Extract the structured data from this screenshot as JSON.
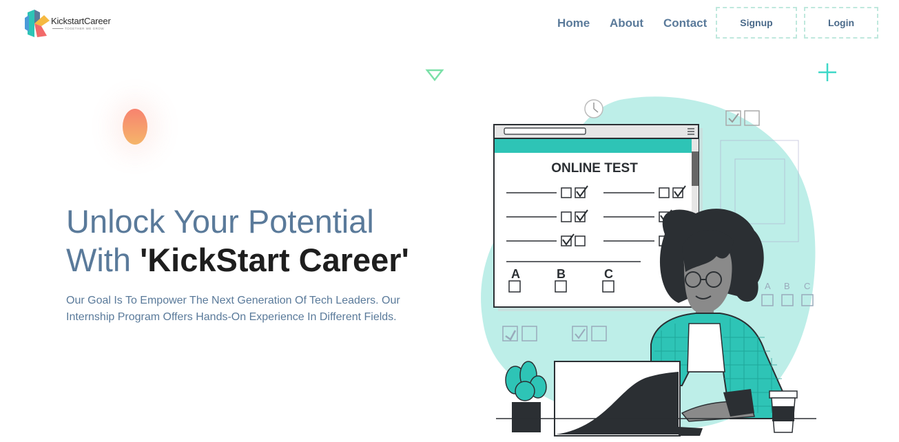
{
  "header": {
    "logo": {
      "name": "KickstartCareer",
      "tagline": "TOGETHER WE GROW"
    },
    "nav": [
      {
        "label": "Home"
      },
      {
        "label": "About"
      },
      {
        "label": "Contact"
      }
    ],
    "buttons": {
      "signup": "Signup",
      "login": "Login"
    }
  },
  "hero": {
    "title_line1": "Unlock Your Potential",
    "title_line2_prefix": "With ",
    "title_line2_brand": "'KickStart Career'",
    "description": "Our Goal Is To Empower The Next Generation Of Tech Leaders. Our Internship Program Offers Hands-On Experience In Different Fields."
  },
  "illustration": {
    "window_title": "ONLINE TEST",
    "options": [
      "A",
      "B",
      "C"
    ],
    "side_options": [
      "A",
      "B",
      "C"
    ]
  },
  "colors": {
    "accent": "#2ec4b6",
    "nav_text": "#5a7a9a",
    "blob_bg": "#bdeee8"
  }
}
